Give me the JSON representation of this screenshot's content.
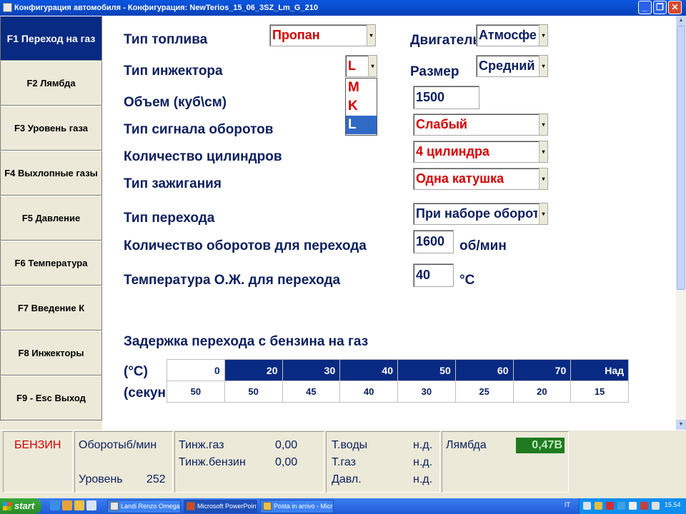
{
  "window": {
    "title": "Конфигурация автомобиля - Конфигурация: NewTerios_15_06_3SZ_Lm_G_210",
    "buttons": [
      "_",
      "❐",
      "✕"
    ]
  },
  "sidebar": {
    "items": [
      {
        "label": "F1 Переход на газ",
        "active": true
      },
      {
        "label": "F2 Лямбда"
      },
      {
        "label": "F3 Уровень газа"
      },
      {
        "label": "F4 Выхлопные газы"
      },
      {
        "label": "F5 Давление"
      },
      {
        "label": "F6 Температура"
      },
      {
        "label": "F7 Введение К"
      },
      {
        "label": "F8 Инжекторы"
      },
      {
        "label": "F9 - Esc Выход"
      }
    ]
  },
  "form": {
    "fuel_type": {
      "label": "Тип топлива",
      "value": "Пропан"
    },
    "engine": {
      "label": "Двигатель",
      "value": "Атмосфе"
    },
    "injector_type": {
      "label": "Тип инжектора",
      "value": "L",
      "options": [
        "M",
        "K",
        "L"
      ]
    },
    "size": {
      "label": "Размер",
      "value": "Средний"
    },
    "volume": {
      "label": "Объем (куб\\см)",
      "value": "1500"
    },
    "rpm_signal": {
      "label": "Тип сигнала оборотов",
      "value": "Слабый"
    },
    "cylinders": {
      "label": "Количество цилиндров",
      "value": "4 цилиндра"
    },
    "ignition": {
      "label": "Тип зажигания",
      "value": "Одна катушка"
    },
    "switch_type": {
      "label": "Тип перехода",
      "value": "При наборе оборот"
    },
    "switch_rpm": {
      "label": "Количество оборотов для перехода",
      "value": "1600",
      "unit": "об/мин"
    },
    "switch_temp": {
      "label": "Температура О.Ж. для перехода",
      "value": "40",
      "unit": "°C"
    }
  },
  "delay_table": {
    "title": "Задержка перехода с бензина на газ",
    "row1_label": "(°C)",
    "row2_label": "(секун",
    "headers": [
      "0",
      "20",
      "30",
      "40",
      "50",
      "60",
      "70",
      "Над"
    ],
    "values": [
      "50",
      "50",
      "45",
      "40",
      "30",
      "25",
      "20",
      "15"
    ]
  },
  "status": {
    "fuel_mode": "БЕНЗИН",
    "rpm_label": "Оборотыб/мин",
    "level_label": "Уровень",
    "level_value": "252",
    "tinj_gas_label": "Тинж.газ",
    "tinj_gas_value": "0,00",
    "tinj_petrol_label": "Тинж.бензин",
    "tinj_petrol_value": "0,00",
    "water_temp_label": "Т.воды",
    "water_temp_value": "н.д.",
    "gas_temp_label": "Т.газ",
    "gas_temp_value": "н.д.",
    "pressure_label": "Давл.",
    "pressure_value": "н.д.",
    "lambda_label": "Лямбда",
    "lambda_value": "0,47В"
  },
  "taskbar": {
    "start_label": "start",
    "tasks": [
      "Landi Renzo Omegas",
      "Microsoft PowerPoint ...",
      "Posta in arrivo - Micro..."
    ],
    "language": "IT",
    "clock": "15.54"
  },
  "colors": {
    "accent": "#082a82",
    "value_red": "#d40000",
    "lambda_green": "#1f7a1f"
  }
}
